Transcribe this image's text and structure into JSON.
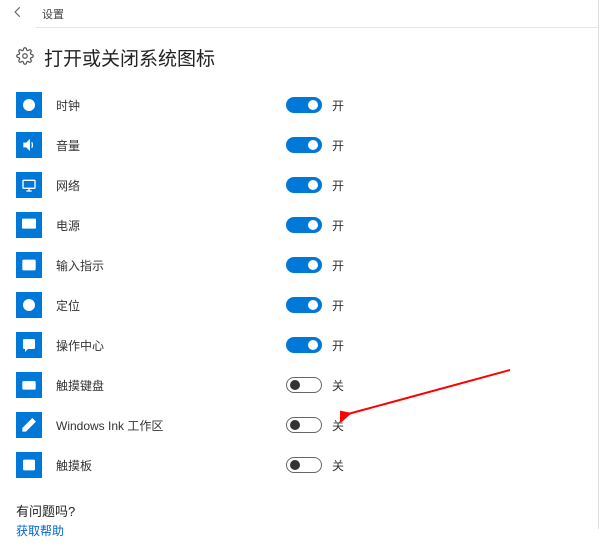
{
  "titlebar": {
    "label": "设置"
  },
  "header": {
    "title": "打开或关闭系统图标"
  },
  "state_labels": {
    "on": "开",
    "off": "关"
  },
  "settings": [
    {
      "key": "clock",
      "label": "时钟",
      "on": true,
      "icon": "clock"
    },
    {
      "key": "volume",
      "label": "音量",
      "on": true,
      "icon": "volume"
    },
    {
      "key": "network",
      "label": "网络",
      "on": true,
      "icon": "network"
    },
    {
      "key": "power",
      "label": "电源",
      "on": true,
      "icon": "power"
    },
    {
      "key": "ime",
      "label": "输入指示",
      "on": true,
      "icon": "ime"
    },
    {
      "key": "location",
      "label": "定位",
      "on": true,
      "icon": "location"
    },
    {
      "key": "actioncenter",
      "label": "操作中心",
      "on": true,
      "icon": "actioncenter"
    },
    {
      "key": "touchkeyboard",
      "label": "触摸键盘",
      "on": false,
      "icon": "keyboard"
    },
    {
      "key": "windowsink",
      "label": "Windows Ink 工作区",
      "on": false,
      "icon": "pen"
    },
    {
      "key": "touchpad",
      "label": "触摸板",
      "on": false,
      "icon": "touchpad"
    }
  ],
  "help": {
    "question": "有问题吗?",
    "link": "获取帮助"
  },
  "annotation": {
    "target": "windowsink",
    "color": "#ff0000"
  }
}
